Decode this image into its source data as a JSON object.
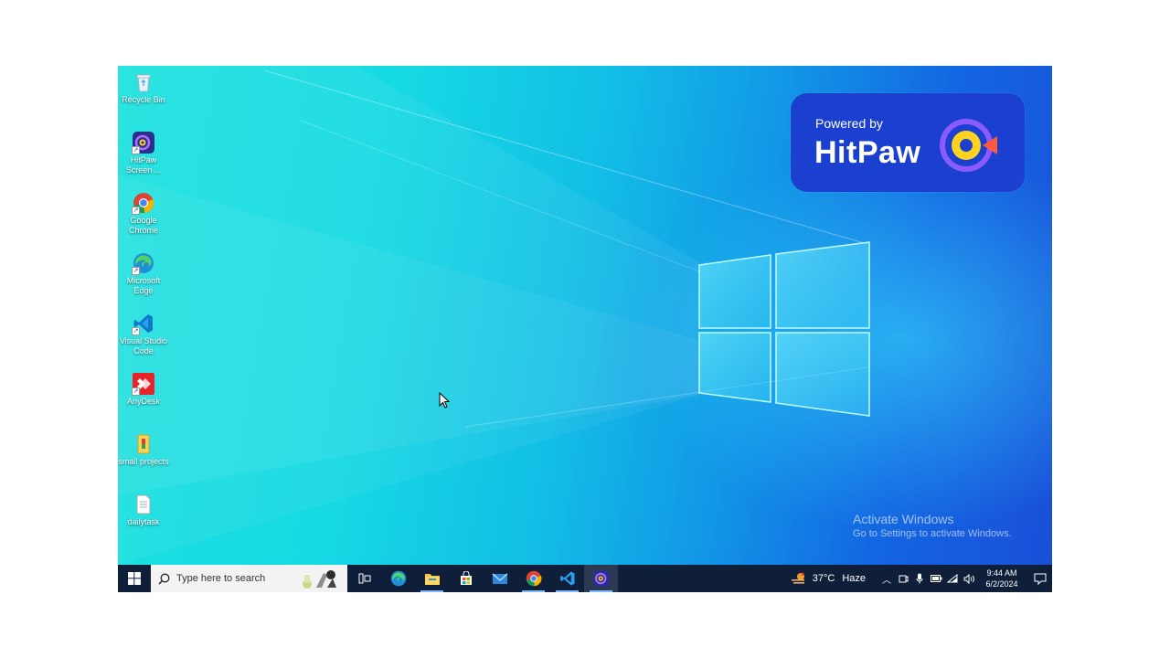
{
  "desktop": {
    "icons": [
      {
        "label": "Recycle Bin",
        "icon": "recycle-bin-icon"
      },
      {
        "label": "HitPaw Screen ...",
        "icon": "hitpaw-icon"
      },
      {
        "label": "Google Chrome",
        "icon": "chrome-icon"
      },
      {
        "label": "Microsoft Edge",
        "icon": "edge-icon"
      },
      {
        "label": "Visual Studio Code",
        "icon": "vscode-icon"
      },
      {
        "label": "AnyDesk",
        "icon": "anydesk-icon"
      },
      {
        "label": "small projects",
        "icon": "folder-icon"
      },
      {
        "label": "dailytask",
        "icon": "text-file-icon"
      }
    ]
  },
  "banner": {
    "powered_by": "Powered by",
    "brand": "HitPaw"
  },
  "activation": {
    "title": "Activate Windows",
    "subtitle": "Go to Settings to activate Windows."
  },
  "taskbar": {
    "search_placeholder": "Type here to search",
    "apps": [
      {
        "name": "Task View",
        "icon": "task-view-icon"
      },
      {
        "name": "Microsoft Edge",
        "icon": "edge-icon"
      },
      {
        "name": "File Explorer",
        "icon": "file-explorer-icon"
      },
      {
        "name": "Microsoft Store",
        "icon": "store-icon"
      },
      {
        "name": "Mail",
        "icon": "mail-icon"
      },
      {
        "name": "Google Chrome",
        "icon": "chrome-icon"
      },
      {
        "name": "Visual Studio Code",
        "icon": "vscode-icon"
      },
      {
        "name": "HitPaw Screen Recorder",
        "icon": "hitpaw-icon"
      }
    ],
    "weather": {
      "temp": "37°C",
      "condition": "Haze"
    },
    "clock": {
      "time": "9:44 AM",
      "date": "6/2/2024"
    }
  },
  "colors": {
    "taskbar": "#0f1f3a",
    "banner": "#1b3fcf",
    "wallpaper_left": "#1de3df",
    "wallpaper_right": "#1a4fd8"
  }
}
